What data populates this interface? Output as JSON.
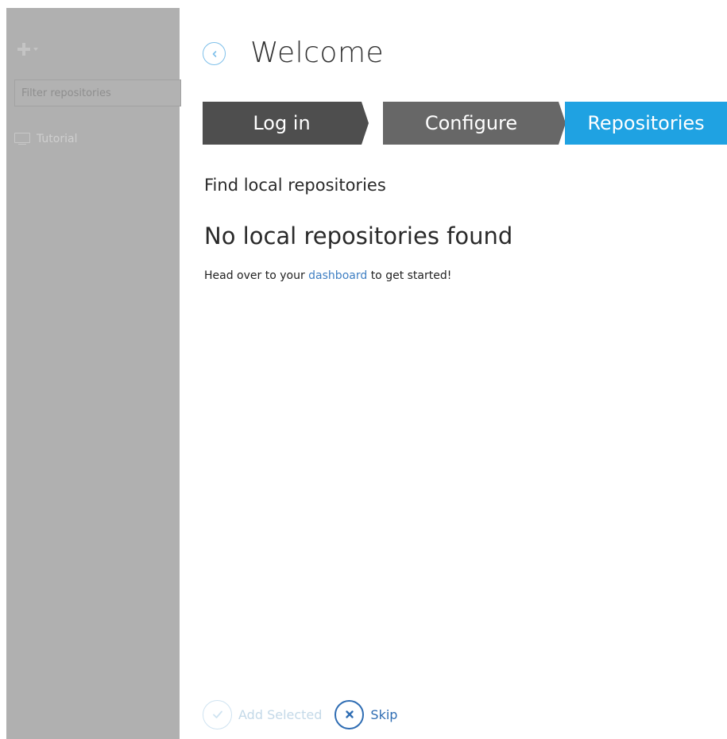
{
  "sidebar": {
    "filter_placeholder": "Filter repositories",
    "repositories": [
      {
        "label": "Tutorial",
        "icon": "monitor-icon"
      }
    ]
  },
  "header": {
    "title": "Welcome"
  },
  "steps": [
    {
      "label": "Log in",
      "state": "completed"
    },
    {
      "label": "Configure",
      "state": "completed"
    },
    {
      "label": "Repositories",
      "state": "active"
    }
  ],
  "content": {
    "section_title": "Find local repositories",
    "empty_title": "No local repositories found",
    "hint_prefix": "Head over to your",
    "hint_link": "dashboard",
    "hint_suffix": "to get started!"
  },
  "actions": {
    "add_selected_label": "Add Selected",
    "skip_label": "Skip"
  },
  "colors": {
    "accent": "#1fa2e2",
    "link": "#3f7fc3",
    "sidebar_bg": "#b0b0b0"
  }
}
